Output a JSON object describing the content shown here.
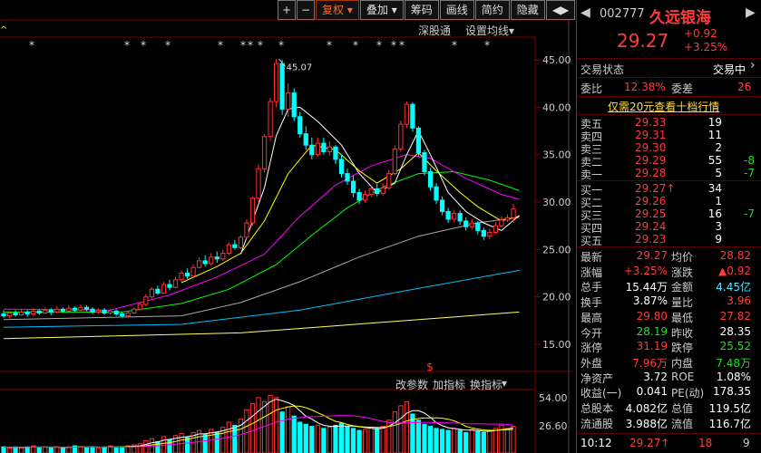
{
  "toolbar": {
    "plus": "+",
    "minus": "−",
    "fuquan": "复权",
    "diejia": "叠加",
    "choumа": "筹码",
    "huaxian": "画线",
    "jianyue": "简约",
    "yincang": "隐藏",
    "arrows": "◀▶"
  },
  "chart_header": {
    "shengutong": "深股通",
    "settings": "设置均线"
  },
  "price_axis": [
    "45.00",
    "40.00",
    "35.00",
    "30.00",
    "25.00",
    "20.00",
    "15.00"
  ],
  "max_label": "45.07",
  "vol_header": {
    "gaicanshu": "改参数",
    "zhibiao": "加指标",
    "huanzhibiao": "换指标"
  },
  "vol_axis": [
    "54.00",
    "26.60"
  ],
  "dollar_mark": "$",
  "colors": {
    "up": "#ff3030",
    "down": "#00ffff",
    "ma5": "#ffffff",
    "ma10": "#ffff00",
    "ma20": "#ff00ff",
    "ma30": "#00ff00",
    "ma60": "#aaaaaa",
    "ma120": "#00bfff",
    "ma250": "#ffff66"
  },
  "stock": {
    "code": "002777",
    "name": "久远银海",
    "price": "29.27",
    "change": "+0.92",
    "pct": "+3.25%"
  },
  "state": {
    "label": "交易状态",
    "value": "交易中"
  },
  "weibi": {
    "label": "委比",
    "value": "12.38%",
    "cha_label": "委差",
    "cha_value": "26"
  },
  "notice": "仅需20元查看十档行情",
  "asks": [
    {
      "label": "卖五",
      "price": "29.33",
      "vol": "19",
      "chg": ""
    },
    {
      "label": "卖四",
      "price": "29.31",
      "vol": "11",
      "chg": ""
    },
    {
      "label": "卖三",
      "price": "29.30",
      "vol": "2",
      "chg": ""
    },
    {
      "label": "卖二",
      "price": "29.29",
      "vol": "55",
      "chg": "-8"
    },
    {
      "label": "卖一",
      "price": "29.28",
      "vol": "5",
      "chg": "-7"
    }
  ],
  "bids": [
    {
      "label": "买一",
      "price": "29.27↑",
      "vol": "34",
      "chg": ""
    },
    {
      "label": "买二",
      "price": "29.26",
      "vol": "1",
      "chg": ""
    },
    {
      "label": "买三",
      "price": "29.25",
      "vol": "16",
      "chg": "-7"
    },
    {
      "label": "买四",
      "price": "29.24",
      "vol": "3",
      "chg": ""
    },
    {
      "label": "买五",
      "price": "29.23",
      "vol": "9",
      "chg": ""
    }
  ],
  "stats": [
    {
      "l1": "最新",
      "v1": "29.27",
      "c1": "red",
      "l2": "均价",
      "v2": "28.82",
      "c2": "red"
    },
    {
      "l1": "涨幅",
      "v1": "+3.25%",
      "c1": "red",
      "l2": "涨跌",
      "v2": "▲0.92",
      "c2": "red"
    },
    {
      "l1": "总手",
      "v1": "15.44万",
      "c1": "white",
      "l2": "金额",
      "v2": "4.45亿",
      "c2": "cyan"
    },
    {
      "l1": "换手",
      "v1": "3.87%",
      "c1": "white",
      "l2": "量比",
      "v2": "3.96",
      "c2": "red"
    },
    {
      "l1": "最高",
      "v1": "29.80",
      "c1": "red",
      "l2": "最低",
      "v2": "27.82",
      "c2": "red"
    },
    {
      "l1": "今开",
      "v1": "28.19",
      "c1": "green",
      "l2": "昨收",
      "v2": "28.35",
      "c2": "white"
    },
    {
      "l1": "涨停",
      "v1": "31.19",
      "c1": "red",
      "l2": "跌停",
      "v2": "25.52",
      "c2": "green"
    },
    {
      "l1": "外盘",
      "v1": "7.96万",
      "c1": "red",
      "l2": "内盘",
      "v2": "7.48万",
      "c2": "green"
    },
    {
      "l1": "净资产",
      "v1": "3.72",
      "c1": "white",
      "l2": "ROE",
      "v2": "1.08%",
      "c2": "white"
    },
    {
      "l1": "收益(一)",
      "v1": "0.041",
      "c1": "white",
      "l2": "PE(动)",
      "v2": "178.35",
      "c2": "white"
    },
    {
      "l1": "总股本",
      "v1": "4.082亿",
      "c1": "white",
      "l2": "总值",
      "v2": "119.5亿",
      "c2": "white"
    },
    {
      "l1": "流通股",
      "v1": "3.988亿",
      "c1": "white",
      "l2": "流值",
      "v2": "116.7亿",
      "c2": "white"
    }
  ],
  "tick": {
    "time": "10:12",
    "price": "29.27↑",
    "vol": "18",
    "n": "9"
  },
  "chart_data": {
    "type": "candlestick",
    "ylim": [
      15,
      45
    ],
    "candles": [
      [
        18.2,
        18.0,
        18.6,
        17.8
      ],
      [
        18.0,
        18.3,
        18.5,
        17.8
      ],
      [
        18.3,
        18.1,
        18.6,
        17.9
      ],
      [
        18.1,
        18.4,
        18.7,
        18.0
      ],
      [
        18.4,
        18.2,
        18.6,
        17.9
      ],
      [
        18.2,
        18.5,
        18.8,
        18.0
      ],
      [
        18.5,
        18.3,
        18.7,
        18.1
      ],
      [
        18.3,
        18.6,
        18.9,
        18.2
      ],
      [
        18.6,
        18.4,
        18.8,
        18.1
      ],
      [
        18.4,
        18.7,
        19.0,
        18.3
      ],
      [
        18.7,
        18.5,
        18.9,
        18.3
      ],
      [
        18.5,
        18.8,
        19.1,
        18.4
      ],
      [
        18.8,
        18.6,
        19.0,
        18.4
      ],
      [
        18.6,
        18.9,
        19.2,
        18.5
      ],
      [
        18.9,
        18.7,
        19.1,
        18.5
      ],
      [
        18.7,
        18.4,
        18.9,
        18.2
      ],
      [
        18.4,
        18.6,
        18.8,
        18.2
      ],
      [
        18.6,
        18.3,
        18.8,
        18.1
      ],
      [
        18.3,
        18.5,
        18.7,
        18.1
      ],
      [
        18.5,
        18.2,
        18.7,
        18.0
      ],
      [
        18.2,
        18.0,
        18.4,
        17.8
      ],
      [
        18.0,
        18.3,
        18.5,
        17.9
      ],
      [
        18.3,
        18.7,
        18.9,
        18.2
      ],
      [
        18.7,
        19.2,
        19.4,
        18.6
      ],
      [
        19.2,
        20.0,
        20.3,
        19.0
      ],
      [
        20.0,
        20.8,
        21.0,
        19.8
      ],
      [
        20.8,
        20.4,
        21.2,
        20.2
      ],
      [
        20.4,
        21.3,
        21.6,
        20.3
      ],
      [
        21.3,
        21.0,
        21.8,
        20.7
      ],
      [
        21.0,
        21.8,
        22.1,
        20.9
      ],
      [
        21.8,
        22.5,
        22.8,
        21.6
      ],
      [
        22.5,
        22.2,
        23.0,
        21.9
      ],
      [
        22.2,
        23.1,
        23.4,
        22.0
      ],
      [
        23.1,
        23.8,
        24.2,
        23.0
      ],
      [
        23.8,
        23.5,
        24.4,
        23.2
      ],
      [
        23.5,
        24.2,
        24.6,
        23.3
      ],
      [
        24.2,
        24.0,
        24.8,
        23.6
      ],
      [
        24.0,
        24.6,
        25.0,
        23.8
      ],
      [
        24.6,
        25.5,
        25.8,
        24.4
      ],
      [
        25.5,
        25.2,
        26.0,
        25.0
      ],
      [
        25.2,
        26.3,
        26.5,
        25.0
      ],
      [
        26.3,
        27.8,
        28.2,
        26.1
      ],
      [
        27.8,
        30.4,
        30.6,
        27.5
      ],
      [
        30.4,
        33.5,
        34.0,
        30.0
      ],
      [
        33.5,
        36.9,
        37.2,
        33.1
      ],
      [
        36.9,
        40.6,
        41.0,
        36.5
      ],
      [
        40.6,
        44.6,
        45.07,
        40.0
      ],
      [
        44.6,
        39.8,
        45.0,
        39.2
      ],
      [
        39.8,
        41.5,
        42.5,
        39.0
      ],
      [
        41.5,
        39.0,
        42.0,
        38.5
      ],
      [
        39.0,
        37.2,
        39.5,
        36.8
      ],
      [
        37.2,
        36.0,
        38.0,
        35.5
      ],
      [
        36.0,
        35.0,
        36.8,
        34.5
      ],
      [
        35.0,
        36.2,
        36.8,
        34.8
      ],
      [
        36.2,
        35.3,
        36.8,
        35.0
      ],
      [
        35.3,
        35.8,
        36.4,
        34.9
      ],
      [
        35.8,
        34.5,
        36.0,
        34.0
      ],
      [
        34.5,
        33.0,
        35.0,
        32.6
      ],
      [
        33.0,
        32.2,
        33.5,
        31.8
      ],
      [
        32.2,
        31.0,
        32.8,
        30.5
      ],
      [
        31.0,
        30.2,
        31.4,
        29.8
      ],
      [
        30.2,
        30.8,
        31.2,
        29.9
      ],
      [
        30.8,
        31.4,
        31.8,
        30.5
      ],
      [
        31.4,
        30.9,
        31.9,
        30.6
      ],
      [
        30.9,
        31.5,
        32.0,
        30.7
      ],
      [
        31.5,
        33.0,
        33.4,
        31.3
      ],
      [
        33.0,
        35.6,
        36.0,
        32.8
      ],
      [
        35.6,
        38.2,
        38.6,
        35.3
      ],
      [
        38.2,
        40.3,
        40.6,
        37.8
      ],
      [
        40.3,
        37.8,
        40.5,
        37.4
      ],
      [
        37.8,
        35.2,
        38.0,
        34.8
      ],
      [
        35.2,
        33.2,
        35.5,
        32.8
      ],
      [
        33.2,
        31.6,
        33.6,
        31.2
      ],
      [
        31.6,
        30.2,
        32.0,
        29.8
      ],
      [
        30.2,
        29.0,
        30.6,
        28.6
      ],
      [
        29.0,
        28.2,
        29.4,
        27.8
      ],
      [
        28.2,
        28.8,
        29.2,
        27.9
      ],
      [
        28.8,
        28.0,
        29.1,
        27.6
      ],
      [
        28.0,
        27.4,
        28.4,
        27.0
      ],
      [
        27.4,
        27.8,
        28.2,
        27.1
      ],
      [
        27.8,
        27.0,
        28.0,
        26.6
      ],
      [
        27.0,
        26.4,
        27.3,
        26.0
      ],
      [
        26.4,
        26.8,
        27.2,
        26.1
      ],
      [
        26.8,
        27.5,
        27.9,
        26.6
      ],
      [
        27.5,
        28.1,
        28.5,
        27.3
      ],
      [
        28.1,
        28.35,
        28.7,
        27.9
      ],
      [
        28.35,
        29.27,
        29.8,
        27.82
      ]
    ],
    "ma": {
      "ma5": [
        [
          40,
          24.5
        ],
        [
          44,
          31.5
        ],
        [
          46,
          37
        ],
        [
          48,
          39.8
        ],
        [
          50,
          40.0
        ],
        [
          53,
          38.5
        ],
        [
          57,
          36
        ],
        [
          60,
          33
        ],
        [
          63,
          31.0
        ],
        [
          66,
          32.0
        ],
        [
          68,
          35.0
        ],
        [
          70,
          37.5
        ],
        [
          72,
          35.0
        ],
        [
          75,
          31.0
        ],
        [
          78,
          29.0
        ],
        [
          81,
          27.8
        ],
        [
          84,
          27.0
        ],
        [
          87,
          28.6
        ]
      ],
      "ma10": [
        [
          30,
          21.5
        ],
        [
          36,
          23.2
        ],
        [
          40,
          24.6
        ],
        [
          44,
          28
        ],
        [
          48,
          33
        ],
        [
          52,
          36.0
        ],
        [
          56,
          35.5
        ],
        [
          60,
          33.3
        ],
        [
          63,
          32.0
        ],
        [
          67,
          33.5
        ],
        [
          70,
          35.2
        ],
        [
          73,
          33.3
        ],
        [
          77,
          31.0
        ],
        [
          80,
          29.5
        ],
        [
          84,
          28.0
        ],
        [
          87,
          28.5
        ]
      ],
      "ma20": [
        [
          0,
          18.7
        ],
        [
          18,
          18.6
        ],
        [
          28,
          20.2
        ],
        [
          36,
          22.1
        ],
        [
          44,
          24.5
        ],
        [
          50,
          28.5
        ],
        [
          56,
          31.8
        ],
        [
          62,
          33.8
        ],
        [
          68,
          35.0
        ],
        [
          72,
          34.6
        ],
        [
          78,
          32.5
        ],
        [
          84,
          30.8
        ],
        [
          87,
          30.3
        ]
      ],
      "ma30": [
        [
          0,
          18.4
        ],
        [
          20,
          18.4
        ],
        [
          30,
          19.3
        ],
        [
          38,
          20.8
        ],
        [
          46,
          23.4
        ],
        [
          52,
          26.5
        ],
        [
          58,
          29.4
        ],
        [
          64,
          31.6
        ],
        [
          70,
          33.0
        ],
        [
          76,
          33.2
        ],
        [
          82,
          32.3
        ],
        [
          87,
          31.2
        ]
      ],
      "ma60": [
        [
          0,
          17.6
        ],
        [
          30,
          18.0
        ],
        [
          40,
          19.4
        ],
        [
          50,
          21.6
        ],
        [
          60,
          24.2
        ],
        [
          70,
          26.4
        ],
        [
          80,
          27.8
        ],
        [
          87,
          28.4
        ]
      ],
      "ma120": [
        [
          0,
          16.8
        ],
        [
          30,
          17.1
        ],
        [
          50,
          18.6
        ],
        [
          70,
          20.9
        ],
        [
          87,
          22.8
        ]
      ],
      "ma250": [
        [
          0,
          15.6
        ],
        [
          40,
          16.2
        ],
        [
          70,
          17.6
        ],
        [
          87,
          18.4
        ]
      ]
    },
    "volume": [
      6,
      5,
      6,
      5,
      6,
      7,
      5,
      6,
      5,
      6,
      5,
      6,
      7,
      6,
      5,
      6,
      5,
      6,
      7,
      5,
      6,
      7,
      8,
      9,
      12,
      14,
      11,
      16,
      13,
      17,
      19,
      15,
      20,
      22,
      18,
      23,
      20,
      25,
      30,
      27,
      33,
      42,
      48,
      54,
      50,
      56,
      54,
      40,
      45,
      36,
      30,
      28,
      26,
      27,
      24,
      25,
      27,
      29,
      26,
      24,
      22,
      23,
      25,
      24,
      26,
      32,
      40,
      46,
      50,
      38,
      32,
      28,
      26,
      24,
      23,
      22,
      24,
      22,
      20,
      23,
      21,
      20,
      22,
      24,
      27,
      24,
      26
    ],
    "vol_ylim": [
      0,
      60
    ]
  }
}
